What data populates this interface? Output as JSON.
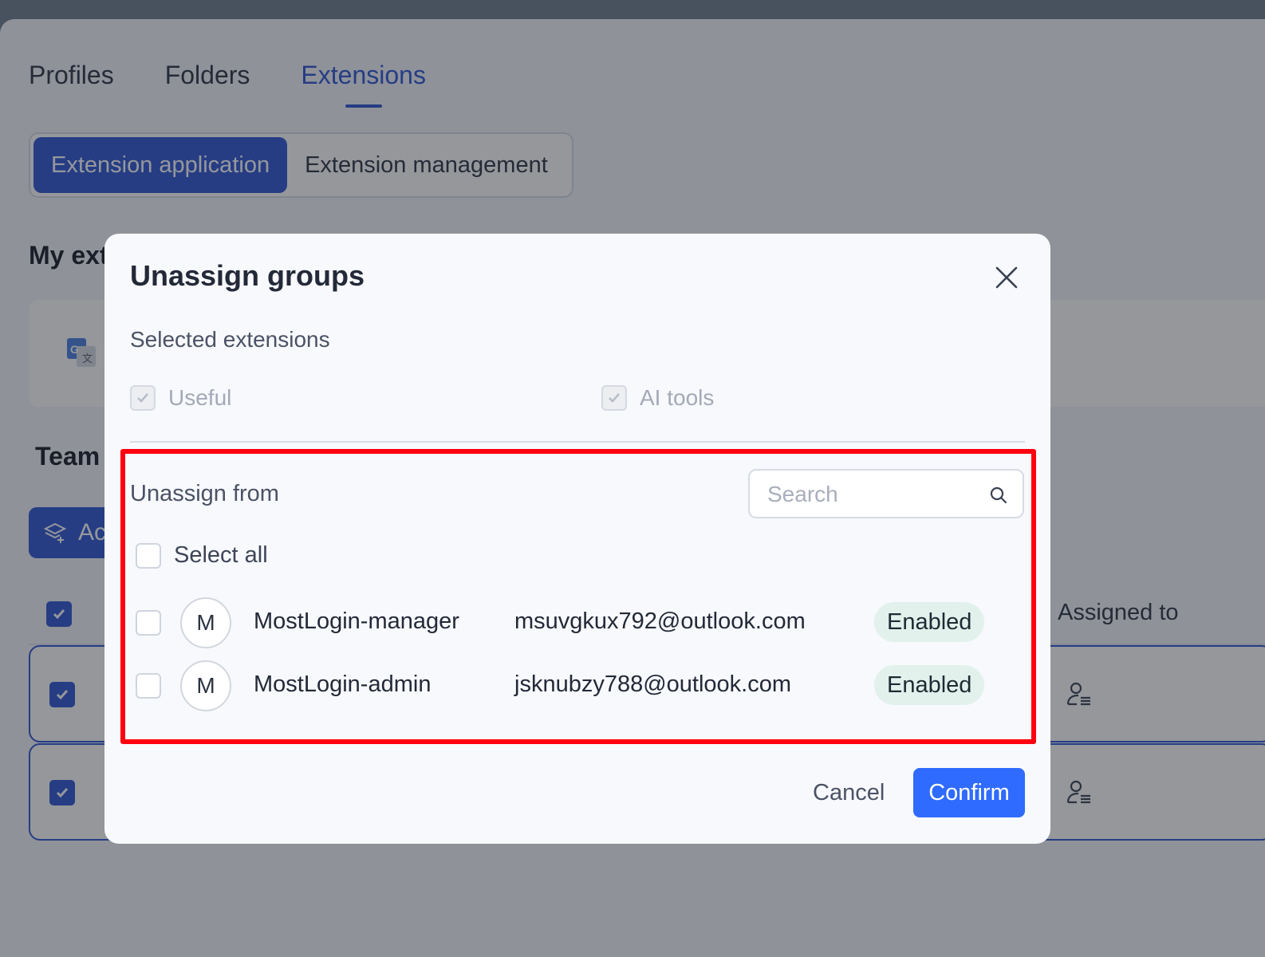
{
  "tabs": [
    {
      "label": "Profiles",
      "active": false
    },
    {
      "label": "Folders",
      "active": false
    },
    {
      "label": "Extensions",
      "active": true
    }
  ],
  "segments": {
    "application": "Extension application",
    "management": "Extension management"
  },
  "background": {
    "my_extensions_title": "My ext",
    "team_title": "Team",
    "add_button_label": "Ac",
    "assigned_to_header": "Assigned to"
  },
  "modal": {
    "title": "Unassign groups",
    "selected_extensions_label": "Selected extensions",
    "extensions": [
      {
        "label": "Useful",
        "checked": true,
        "disabled": true
      },
      {
        "label": "AI tools",
        "checked": true,
        "disabled": true
      }
    ],
    "unassign_from_label": "Unassign from",
    "search_placeholder": "Search",
    "select_all_label": "Select all",
    "groups": [
      {
        "avatar": "M",
        "name": "MostLogin-manager",
        "email": "msuvgkux792@outlook.com",
        "status": "Enabled"
      },
      {
        "avatar": "M",
        "name": "MostLogin-admin",
        "email": "jsknubzy788@outlook.com",
        "status": "Enabled"
      }
    ],
    "cancel_label": "Cancel",
    "confirm_label": "Confirm"
  },
  "colors": {
    "accent": "#2f56d4",
    "confirm": "#2f6bff",
    "highlight": "#ff0010",
    "badge_bg": "#e2f1ec"
  }
}
